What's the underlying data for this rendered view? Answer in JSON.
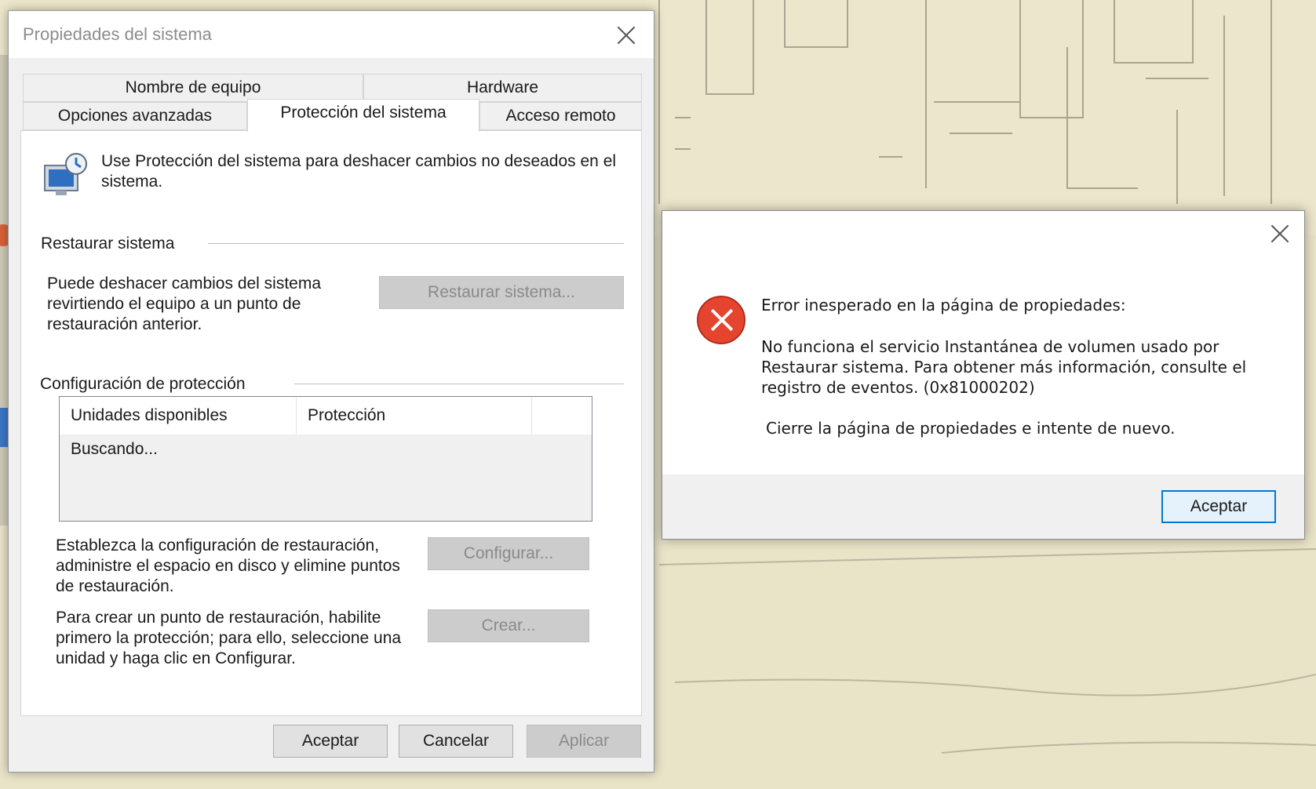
{
  "system_properties": {
    "title": "Propiedades del sistema",
    "tabs": [
      {
        "label": "Nombre de equipo"
      },
      {
        "label": "Hardware"
      },
      {
        "label": "Opciones avanzadas"
      },
      {
        "label": "Protección del sistema",
        "active": true
      },
      {
        "label": "Acceso remoto"
      }
    ],
    "intro_text": "Use Protección del sistema para deshacer cambios no deseados en el sistema.",
    "restore": {
      "group_label": "Restaurar sistema",
      "description": "Puede deshacer cambios del sistema revirtiendo el equipo a un punto de restauración anterior.",
      "button_label": "Restaurar sistema..."
    },
    "protection": {
      "group_label": "Configuración de protección",
      "columns": [
        "Unidades disponibles",
        "Protección"
      ],
      "status_text": "Buscando...",
      "configure_description": "Establezca la configuración de restauración, administre el espacio en disco y elimine puntos de restauración.",
      "configure_button": "Configurar...",
      "create_description": "Para crear un punto de restauración, habilite primero la protección; para ello, seleccione una unidad y haga clic en Configurar.",
      "create_button": "Crear..."
    },
    "footer": {
      "ok": "Aceptar",
      "cancel": "Cancelar",
      "apply": "Aplicar"
    }
  },
  "error_dialog": {
    "heading": "Error inesperado en la página de propiedades:",
    "message": "No funciona el servicio Instantánea de volumen usado por Restaurar sistema. Para obtener más información, consulte el registro de eventos. (0x81000202)",
    "instruction": "Cierre la página de propiedades e intente de nuevo.",
    "ok_button": "Aceptar",
    "accent_color": "#0078d7",
    "icon": "error-icon"
  }
}
